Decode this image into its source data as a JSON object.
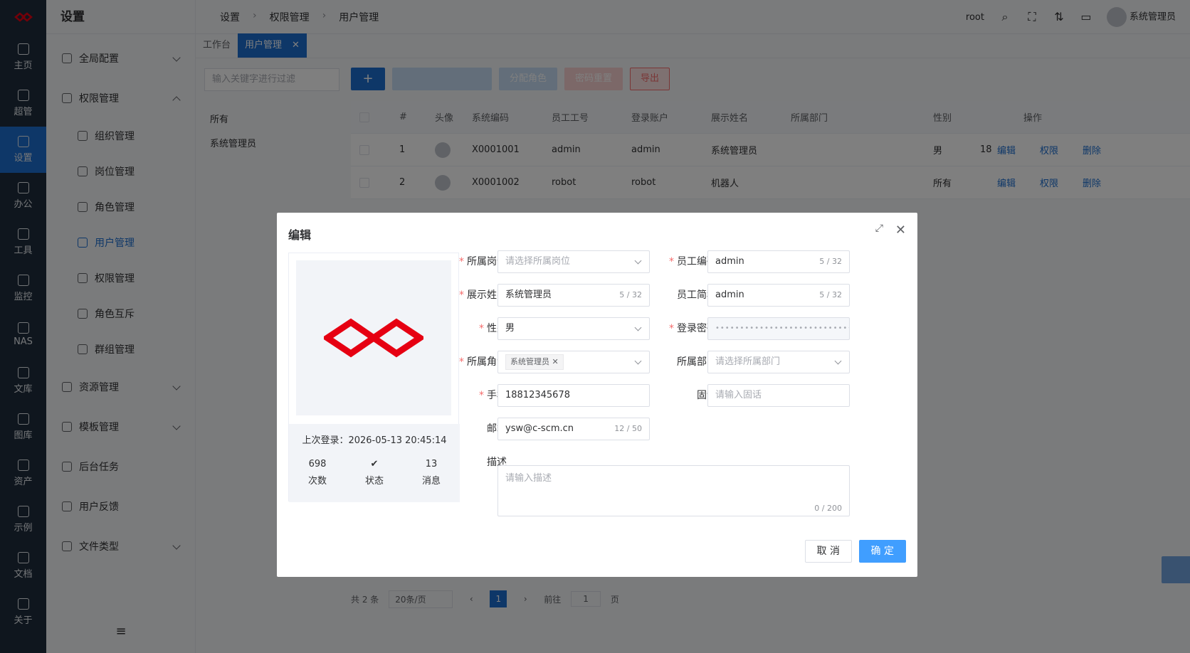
{
  "rail": {
    "items": [
      {
        "label": "主页",
        "icon": "home-icon"
      },
      {
        "label": "超管",
        "icon": "gear-icon"
      },
      {
        "label": "设置",
        "icon": "settings-icon"
      },
      {
        "label": "办公",
        "icon": "briefcase-icon"
      },
      {
        "label": "工具",
        "icon": "tool-icon"
      },
      {
        "label": "监控",
        "icon": "monitor-icon"
      },
      {
        "label": "NAS",
        "icon": "nas-icon"
      },
      {
        "label": "文库",
        "icon": "library-icon"
      },
      {
        "label": "图库",
        "icon": "image-icon"
      },
      {
        "label": "资产",
        "icon": "asset-icon"
      },
      {
        "label": "示例",
        "icon": "example-icon"
      },
      {
        "label": "文档",
        "icon": "doc-icon"
      },
      {
        "label": "关于",
        "icon": "info-icon"
      }
    ]
  },
  "sidebar": {
    "title": "设置",
    "groups": [
      {
        "label": "全局配置"
      },
      {
        "label": "权限管理"
      },
      {
        "label": "组织管理"
      },
      {
        "label": "岗位管理"
      },
      {
        "label": "角色管理"
      },
      {
        "label": "用户管理"
      },
      {
        "label": "权限管理"
      },
      {
        "label": "角色互斥"
      },
      {
        "label": "群组管理"
      },
      {
        "label": "资源管理"
      },
      {
        "label": "模板管理"
      },
      {
        "label": "后台任务"
      },
      {
        "label": "用户反馈"
      },
      {
        "label": "文件类型"
      }
    ],
    "footer": "≡"
  },
  "header": {
    "breadcrumb": [
      "设置",
      "权限管理",
      "用户管理"
    ],
    "user": "root",
    "account": "系统管理员"
  },
  "tabs": [
    {
      "label": "工作台"
    },
    {
      "label": "用户管理"
    }
  ],
  "filter": {
    "placeholder": "输入关键字进行过滤"
  },
  "tree": [
    "所有",
    "系统管理员"
  ],
  "toolbar": {
    "add": "+",
    "assign_role": "分配角色",
    "reset_password": "密码重置",
    "export": "导出"
  },
  "table": {
    "headers": [
      "#",
      "头像",
      "系统编码",
      "员工工号",
      "登录账户",
      "展示姓名",
      "所属部门",
      "性别",
      "操作"
    ],
    "rows": [
      {
        "no": "1",
        "code": "X0001001",
        "emp": "admin",
        "login": "admin",
        "name": "系统管理员",
        "dept": "",
        "gender": "男",
        "extra": "18"
      },
      {
        "no": "2",
        "code": "X0001002",
        "emp": "robot",
        "login": "robot",
        "name": "机器人",
        "dept": "",
        "gender": "所有",
        "extra": ""
      }
    ],
    "actions": [
      "编辑",
      "权限",
      "删除"
    ]
  },
  "pager": {
    "total": "共 2 条",
    "size": "20条/页",
    "page": "1",
    "goto_label": "前往",
    "goto_value": "1",
    "page_unit": "页"
  },
  "modal": {
    "title": "编辑",
    "last_login_label": "上次登录：",
    "last_login": "2026-05-13 20:45:14",
    "stats": [
      {
        "value": "698",
        "label": "次数"
      },
      {
        "value": "✔",
        "label": "状态"
      },
      {
        "value": "13",
        "label": "消息"
      }
    ],
    "fields": {
      "post": {
        "label": "所属岗位",
        "placeholder": "请选择所属岗位"
      },
      "emp_code": {
        "label": "员工编码",
        "value": "admin",
        "count": "5 / 32"
      },
      "display_name": {
        "label": "展示姓名",
        "value": "系统管理员",
        "count": "5 / 32"
      },
      "short_name": {
        "label": "员工简称",
        "value": "admin",
        "count": "5 / 32"
      },
      "gender": {
        "label": "性别",
        "value": "男"
      },
      "password": {
        "label": "登录密码",
        "value": "••••••••••••••••••••••••••••••••••••••••"
      },
      "role": {
        "label": "所属角色",
        "tag": "系统管理员"
      },
      "dept": {
        "label": "所属部门",
        "placeholder": "请选择所属部门"
      },
      "phone": {
        "label": "手机",
        "value": "18812345678"
      },
      "tel": {
        "label": "固话",
        "placeholder": "请输入固话"
      },
      "email": {
        "label": "邮箱",
        "value": "ysw@c-scm.cn",
        "count": "12 / 50"
      },
      "desc": {
        "label": "描述",
        "placeholder": "请输入描述",
        "count": "0 / 200"
      }
    },
    "cancel": "取 消",
    "ok": "确 定"
  },
  "colors": {
    "primary": "#1d6fd1",
    "danger": "#f56c6c",
    "brand_red": "#e60012"
  }
}
